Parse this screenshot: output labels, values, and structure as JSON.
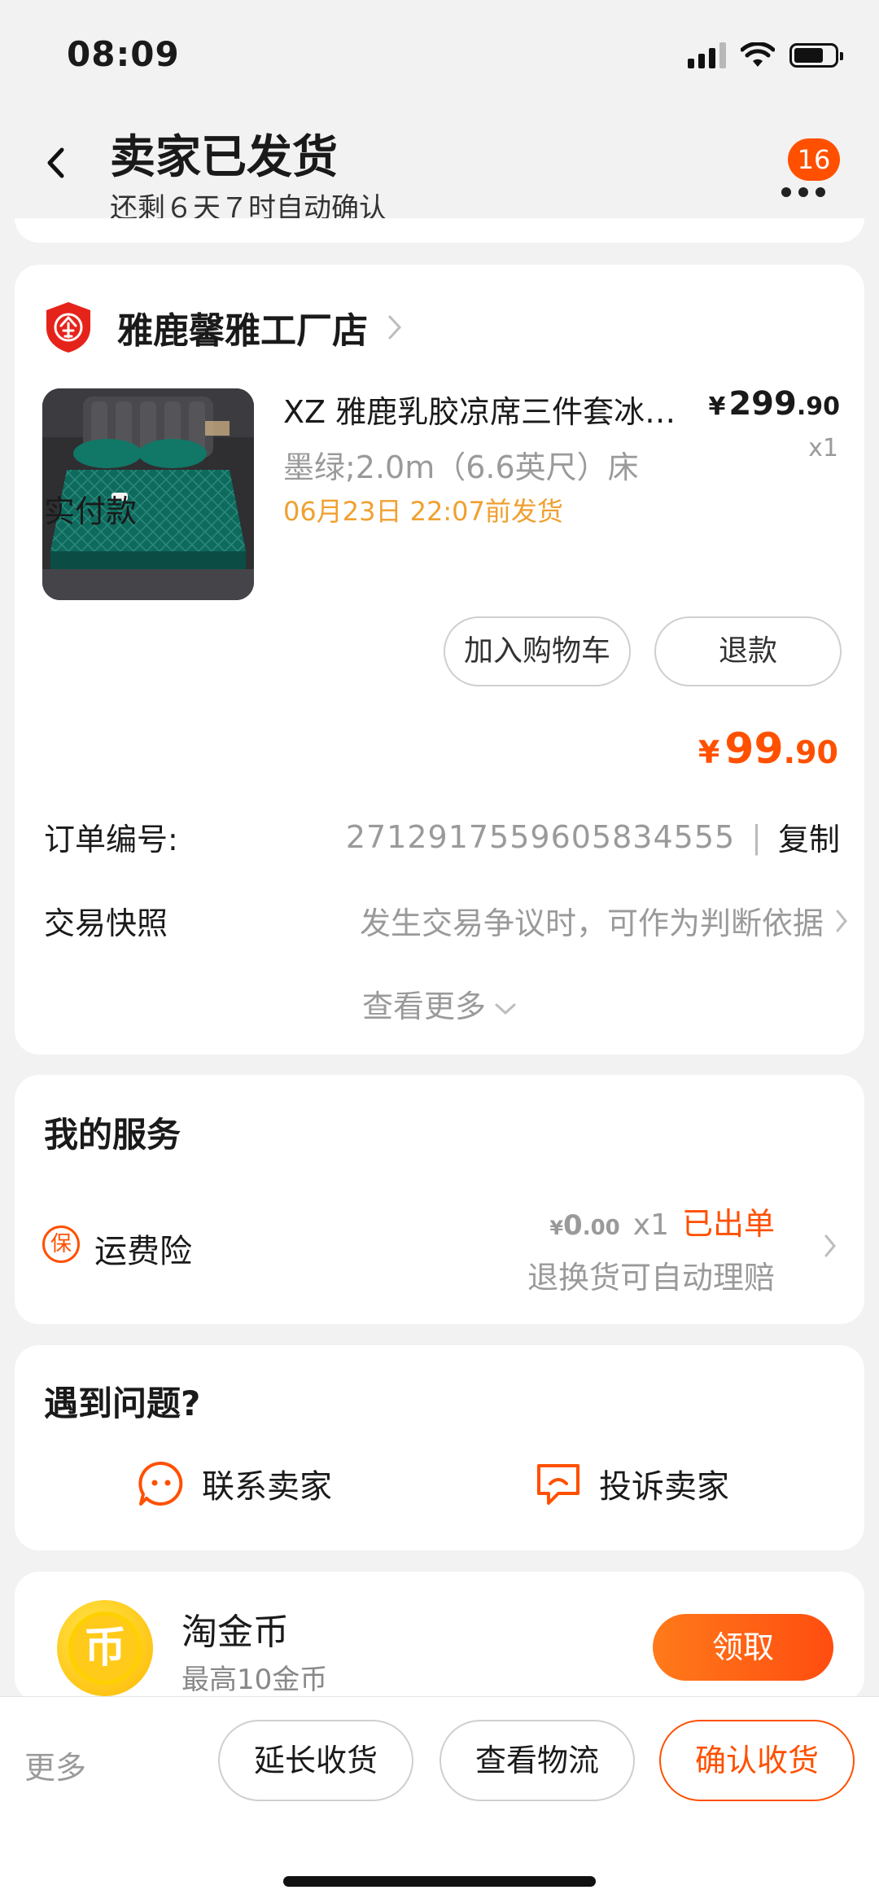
{
  "status_bar": {
    "time": "08:09"
  },
  "header": {
    "title": "卖家已发货",
    "subtitle": "还剩６天７时自动确认",
    "badge_count": "16"
  },
  "order": {
    "shop_name": "雅鹿馨雅工厂店",
    "product": {
      "title": "XZ 雅鹿乳胶凉席三件套冰丝席可折叠",
      "sku": "墨绿;2.0m（6.6英尺）床",
      "ship_time": "06月23日 22:07前发货",
      "price_currency": "¥",
      "price_int": "299",
      "price_dec": ".90",
      "quantity": "x1"
    },
    "actions": {
      "add_to_cart": "加入购物车",
      "refund": "退款"
    },
    "paid_label": "实付款",
    "paid_currency": "¥",
    "paid_int": "99",
    "paid_dec": ".90",
    "order_no_label": "订单编号:",
    "order_no": "2712917559605834555",
    "copy_label": "复制",
    "snapshot_label": "交易快照",
    "snapshot_desc": "发生交易争议时，可作为判断依据",
    "see_more": "查看更多"
  },
  "services": {
    "title": "我的服务",
    "item_icon_text": "保",
    "item_name": "运费险",
    "price_currency": "¥",
    "price_int": "0",
    "price_dec": ".00",
    "quantity": "x1",
    "status": "已出单",
    "desc": "退换货可自动理赔"
  },
  "help": {
    "title": "遇到问题?",
    "contact_seller": "联系卖家",
    "complain_seller": "投诉卖家"
  },
  "coins": {
    "coin_glyph": "币",
    "title": "淘金币",
    "subtitle": "最高10金币",
    "claim": "领取"
  },
  "bottom_bar": {
    "more": "更多",
    "extend": "延长收货",
    "logistics": "查看物流",
    "confirm": "确认收货"
  },
  "colors": {
    "accent": "#ff5000",
    "ship_time": "#f0a030",
    "muted": "#9a9a9a"
  }
}
